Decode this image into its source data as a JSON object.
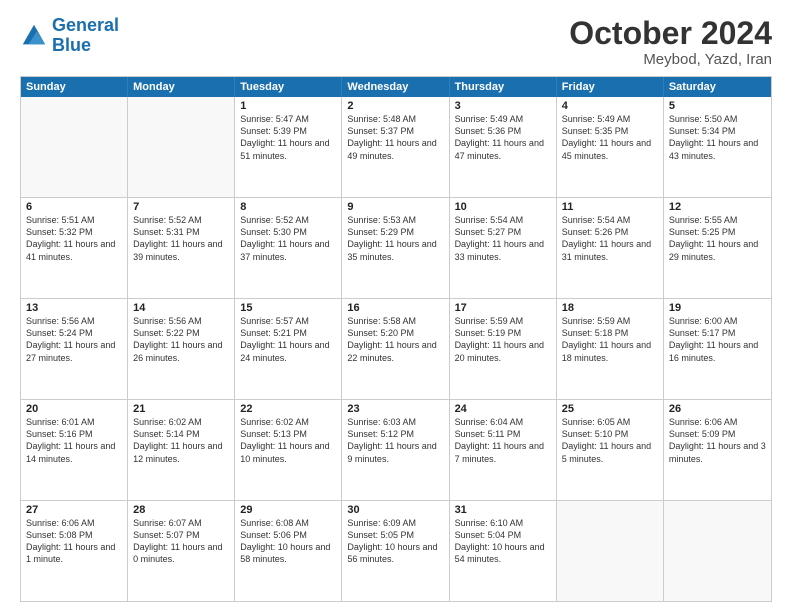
{
  "header": {
    "logo_line1": "General",
    "logo_line2": "Blue",
    "month": "October 2024",
    "location": "Meybod, Yazd, Iran"
  },
  "weekdays": [
    "Sunday",
    "Monday",
    "Tuesday",
    "Wednesday",
    "Thursday",
    "Friday",
    "Saturday"
  ],
  "weeks": [
    [
      {
        "day": "",
        "sunrise": "",
        "sunset": "",
        "daylight": ""
      },
      {
        "day": "",
        "sunrise": "",
        "sunset": "",
        "daylight": ""
      },
      {
        "day": "1",
        "sunrise": "Sunrise: 5:47 AM",
        "sunset": "Sunset: 5:39 PM",
        "daylight": "Daylight: 11 hours and 51 minutes."
      },
      {
        "day": "2",
        "sunrise": "Sunrise: 5:48 AM",
        "sunset": "Sunset: 5:37 PM",
        "daylight": "Daylight: 11 hours and 49 minutes."
      },
      {
        "day": "3",
        "sunrise": "Sunrise: 5:49 AM",
        "sunset": "Sunset: 5:36 PM",
        "daylight": "Daylight: 11 hours and 47 minutes."
      },
      {
        "day": "4",
        "sunrise": "Sunrise: 5:49 AM",
        "sunset": "Sunset: 5:35 PM",
        "daylight": "Daylight: 11 hours and 45 minutes."
      },
      {
        "day": "5",
        "sunrise": "Sunrise: 5:50 AM",
        "sunset": "Sunset: 5:34 PM",
        "daylight": "Daylight: 11 hours and 43 minutes."
      }
    ],
    [
      {
        "day": "6",
        "sunrise": "Sunrise: 5:51 AM",
        "sunset": "Sunset: 5:32 PM",
        "daylight": "Daylight: 11 hours and 41 minutes."
      },
      {
        "day": "7",
        "sunrise": "Sunrise: 5:52 AM",
        "sunset": "Sunset: 5:31 PM",
        "daylight": "Daylight: 11 hours and 39 minutes."
      },
      {
        "day": "8",
        "sunrise": "Sunrise: 5:52 AM",
        "sunset": "Sunset: 5:30 PM",
        "daylight": "Daylight: 11 hours and 37 minutes."
      },
      {
        "day": "9",
        "sunrise": "Sunrise: 5:53 AM",
        "sunset": "Sunset: 5:29 PM",
        "daylight": "Daylight: 11 hours and 35 minutes."
      },
      {
        "day": "10",
        "sunrise": "Sunrise: 5:54 AM",
        "sunset": "Sunset: 5:27 PM",
        "daylight": "Daylight: 11 hours and 33 minutes."
      },
      {
        "day": "11",
        "sunrise": "Sunrise: 5:54 AM",
        "sunset": "Sunset: 5:26 PM",
        "daylight": "Daylight: 11 hours and 31 minutes."
      },
      {
        "day": "12",
        "sunrise": "Sunrise: 5:55 AM",
        "sunset": "Sunset: 5:25 PM",
        "daylight": "Daylight: 11 hours and 29 minutes."
      }
    ],
    [
      {
        "day": "13",
        "sunrise": "Sunrise: 5:56 AM",
        "sunset": "Sunset: 5:24 PM",
        "daylight": "Daylight: 11 hours and 27 minutes."
      },
      {
        "day": "14",
        "sunrise": "Sunrise: 5:56 AM",
        "sunset": "Sunset: 5:22 PM",
        "daylight": "Daylight: 11 hours and 26 minutes."
      },
      {
        "day": "15",
        "sunrise": "Sunrise: 5:57 AM",
        "sunset": "Sunset: 5:21 PM",
        "daylight": "Daylight: 11 hours and 24 minutes."
      },
      {
        "day": "16",
        "sunrise": "Sunrise: 5:58 AM",
        "sunset": "Sunset: 5:20 PM",
        "daylight": "Daylight: 11 hours and 22 minutes."
      },
      {
        "day": "17",
        "sunrise": "Sunrise: 5:59 AM",
        "sunset": "Sunset: 5:19 PM",
        "daylight": "Daylight: 11 hours and 20 minutes."
      },
      {
        "day": "18",
        "sunrise": "Sunrise: 5:59 AM",
        "sunset": "Sunset: 5:18 PM",
        "daylight": "Daylight: 11 hours and 18 minutes."
      },
      {
        "day": "19",
        "sunrise": "Sunrise: 6:00 AM",
        "sunset": "Sunset: 5:17 PM",
        "daylight": "Daylight: 11 hours and 16 minutes."
      }
    ],
    [
      {
        "day": "20",
        "sunrise": "Sunrise: 6:01 AM",
        "sunset": "Sunset: 5:16 PM",
        "daylight": "Daylight: 11 hours and 14 minutes."
      },
      {
        "day": "21",
        "sunrise": "Sunrise: 6:02 AM",
        "sunset": "Sunset: 5:14 PM",
        "daylight": "Daylight: 11 hours and 12 minutes."
      },
      {
        "day": "22",
        "sunrise": "Sunrise: 6:02 AM",
        "sunset": "Sunset: 5:13 PM",
        "daylight": "Daylight: 11 hours and 10 minutes."
      },
      {
        "day": "23",
        "sunrise": "Sunrise: 6:03 AM",
        "sunset": "Sunset: 5:12 PM",
        "daylight": "Daylight: 11 hours and 9 minutes."
      },
      {
        "day": "24",
        "sunrise": "Sunrise: 6:04 AM",
        "sunset": "Sunset: 5:11 PM",
        "daylight": "Daylight: 11 hours and 7 minutes."
      },
      {
        "day": "25",
        "sunrise": "Sunrise: 6:05 AM",
        "sunset": "Sunset: 5:10 PM",
        "daylight": "Daylight: 11 hours and 5 minutes."
      },
      {
        "day": "26",
        "sunrise": "Sunrise: 6:06 AM",
        "sunset": "Sunset: 5:09 PM",
        "daylight": "Daylight: 11 hours and 3 minutes."
      }
    ],
    [
      {
        "day": "27",
        "sunrise": "Sunrise: 6:06 AM",
        "sunset": "Sunset: 5:08 PM",
        "daylight": "Daylight: 11 hours and 1 minute."
      },
      {
        "day": "28",
        "sunrise": "Sunrise: 6:07 AM",
        "sunset": "Sunset: 5:07 PM",
        "daylight": "Daylight: 11 hours and 0 minutes."
      },
      {
        "day": "29",
        "sunrise": "Sunrise: 6:08 AM",
        "sunset": "Sunset: 5:06 PM",
        "daylight": "Daylight: 10 hours and 58 minutes."
      },
      {
        "day": "30",
        "sunrise": "Sunrise: 6:09 AM",
        "sunset": "Sunset: 5:05 PM",
        "daylight": "Daylight: 10 hours and 56 minutes."
      },
      {
        "day": "31",
        "sunrise": "Sunrise: 6:10 AM",
        "sunset": "Sunset: 5:04 PM",
        "daylight": "Daylight: 10 hours and 54 minutes."
      },
      {
        "day": "",
        "sunrise": "",
        "sunset": "",
        "daylight": ""
      },
      {
        "day": "",
        "sunrise": "",
        "sunset": "",
        "daylight": ""
      }
    ]
  ]
}
